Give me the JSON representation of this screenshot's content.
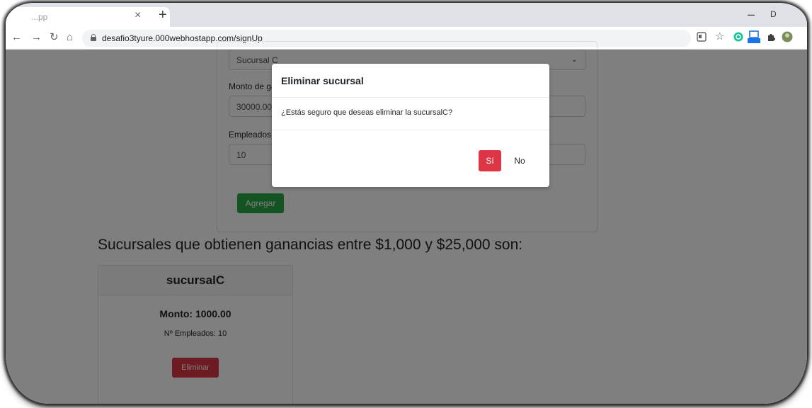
{
  "browser": {
    "tab_title": "...pp",
    "tab_close": "×",
    "new_tab": "+",
    "url": "desafio3tyure.000webhostapp.com/signUp"
  },
  "form": {
    "select_value": "Sucursal C",
    "amount_label": "Monto de ganancias",
    "amount_value": "30000.00",
    "employees_label": "Empleados",
    "employees_value": "10",
    "add_button": "Agregar"
  },
  "list": {
    "heading": "Sucursales que obtienen ganancias entre $1,000 y $25,000 son:",
    "cards": [
      {
        "name": "sucursalC",
        "amount": "Monto: 1000.00",
        "employees": "Nº Empleados: 10",
        "delete_button": "Eliminar"
      }
    ]
  },
  "modal": {
    "title": "Eliminar sucursal",
    "message": "¿Estás seguro que deseas eliminar la sucursalC?",
    "yes_button": "Sí",
    "no_button": "No"
  },
  "colors": {
    "danger": "#dc3545",
    "success": "#28a745",
    "backdrop": "rgba(0,0,0,0.5)"
  }
}
